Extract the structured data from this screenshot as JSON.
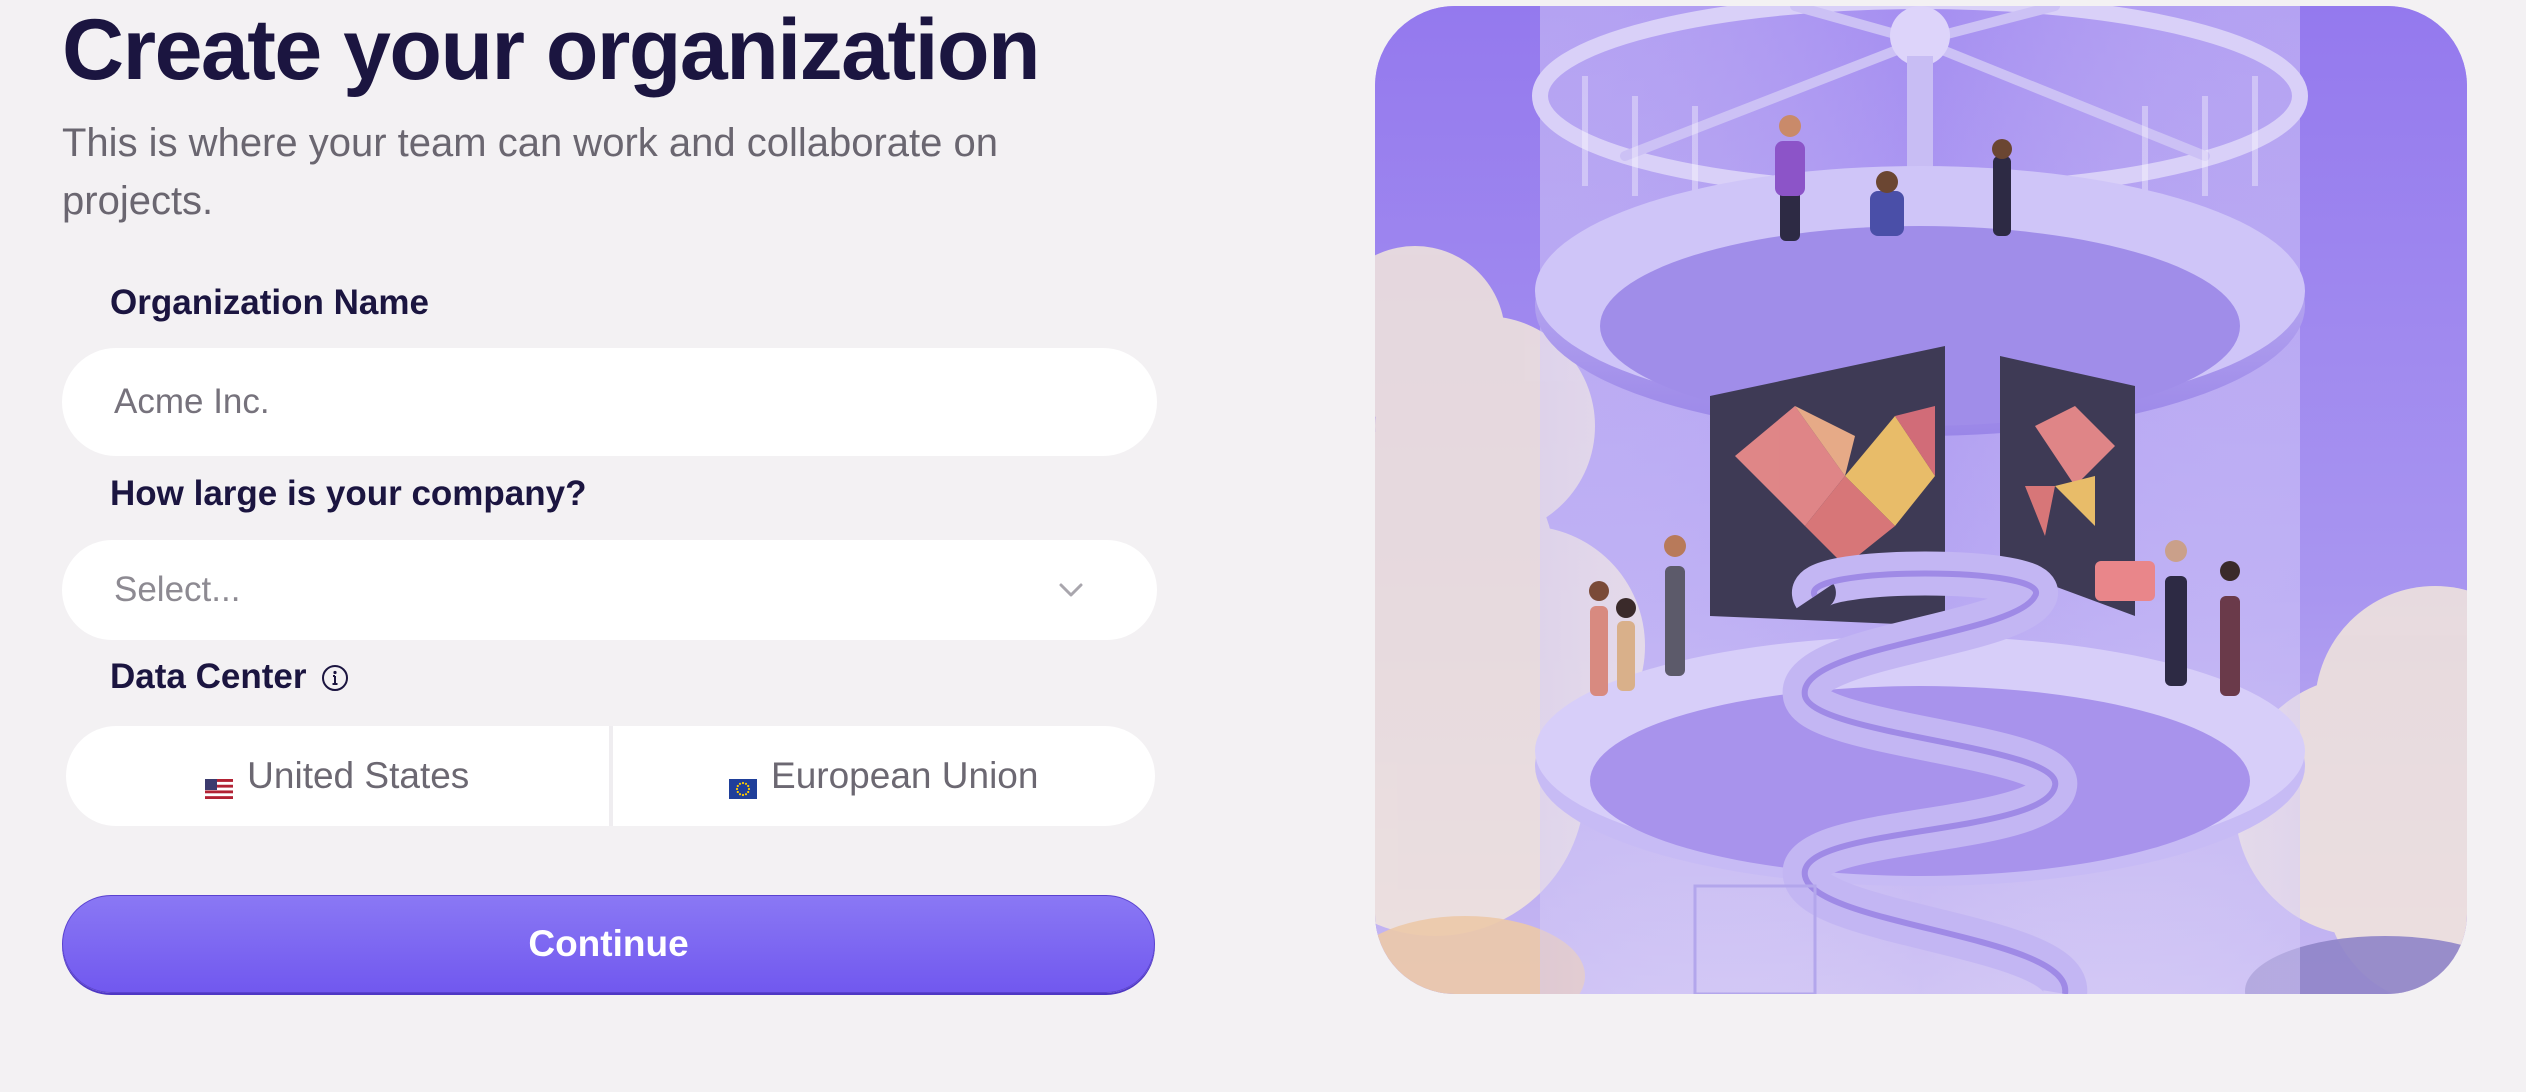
{
  "page": {
    "title": "Create your organization",
    "subtitle": "This is where your team can work and collaborate on projects."
  },
  "form": {
    "org_name": {
      "label": "Organization Name",
      "placeholder": "Acme Inc."
    },
    "company_size": {
      "label": "How large is your company?",
      "placeholder": "Select..."
    },
    "data_center": {
      "label": "Data Center",
      "options": [
        {
          "label": "United States",
          "flag_icon": "us-flag-icon"
        },
        {
          "label": "European Union",
          "flag_icon": "eu-flag-icon"
        }
      ]
    },
    "continue_label": "Continue"
  },
  "colors": {
    "background": "#f3f1f3",
    "heading": "#1b1540",
    "accent": "#7a64f2",
    "illustration_bg": "#9a84ee"
  }
}
